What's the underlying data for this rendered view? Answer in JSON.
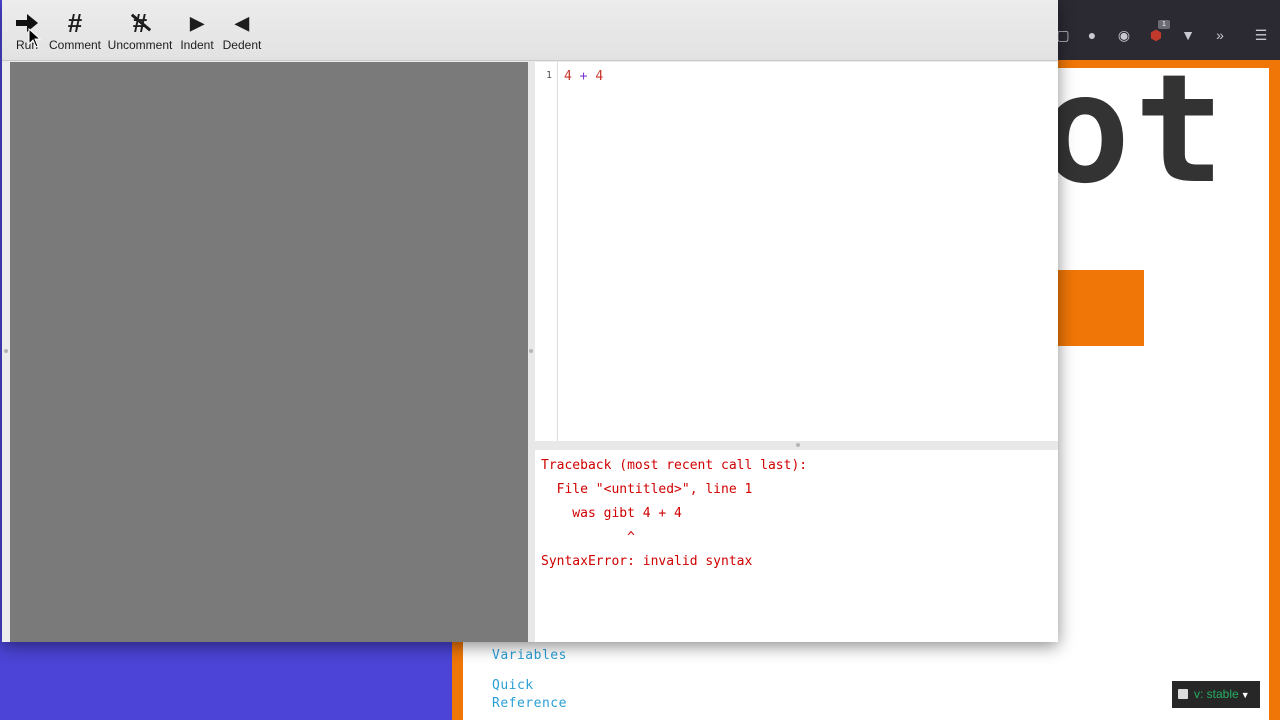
{
  "toolbar": {
    "buttons": [
      {
        "label": "Run",
        "icon": "arrow-right-icon"
      },
      {
        "label": "Comment",
        "icon": "hash-icon"
      },
      {
        "label": "Uncomment",
        "icon": "hash-strike-icon"
      },
      {
        "label": "Indent",
        "icon": "triangle-right-icon"
      },
      {
        "label": "Dedent",
        "icon": "triangle-left-icon"
      }
    ]
  },
  "editor": {
    "line_number": "1",
    "code": {
      "left": "4",
      "op": "+",
      "right": "4"
    }
  },
  "output": {
    "lines": [
      "Traceback (most recent call last):",
      "  File \"<untitled>\", line 1",
      "    was gibt 4 + 4",
      "           ^",
      "SyntaxError: invalid syntax"
    ],
    "color": "#d00000"
  },
  "background_page": {
    "heading_fragment": "ot",
    "sidebar_links": [
      "Variables",
      "Quick",
      "Reference"
    ],
    "version_badge": "v: stable",
    "ublock_count": "1",
    "accent_color": "#f07607",
    "link_color": "#2a9fd6"
  }
}
